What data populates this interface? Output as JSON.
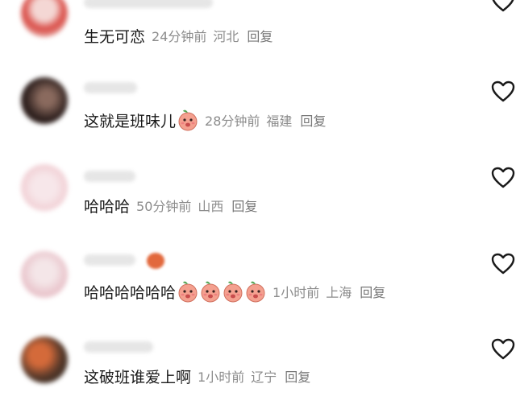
{
  "comments": [
    {
      "text": "生无可恋",
      "time": "24分钟前",
      "region": "河北",
      "reply": "回复",
      "emoji_count": 0
    },
    {
      "text": "这就是班味儿",
      "time": "28分钟前",
      "region": "福建",
      "reply": "回复",
      "emoji_count": 1
    },
    {
      "text": "哈哈哈",
      "time": "50分钟前",
      "region": "山西",
      "reply": "回复",
      "emoji_count": 0
    },
    {
      "text": "哈哈哈哈哈哈",
      "time": "1小时前",
      "region": "上海",
      "reply": "回复",
      "emoji_count": 4
    },
    {
      "text": "这破班谁爱上啊",
      "time": "1小时前",
      "region": "辽宁",
      "reply": "回复",
      "emoji_count": 0
    }
  ],
  "icons": {
    "like": "heart-outline-icon",
    "emoji": "peach-face-emoji-icon"
  },
  "colors": {
    "text": "#1a1a1a",
    "meta": "#8c8c8c",
    "heart_stroke": "#1a1a1a",
    "emoji_fill": "#f4a08f"
  }
}
